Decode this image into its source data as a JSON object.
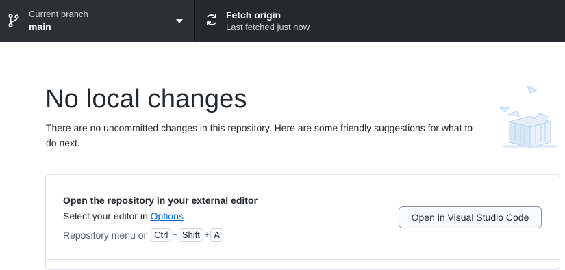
{
  "toolbar": {
    "branch": {
      "label": "Current branch",
      "value": "main",
      "icon": "git-branch-icon"
    },
    "fetch": {
      "title": "Fetch origin",
      "subtitle": "Last fetched just now",
      "icon": "sync-icon"
    }
  },
  "main": {
    "heading": "No local changes",
    "description": "There are no uncommitted changes in this repository. Here are some friendly suggestions for what to do next."
  },
  "suggestion": {
    "title": "Open the repository in your external editor",
    "line_prefix": "Select your editor in ",
    "line_link": "Options",
    "shortcut_prefix": "Repository menu or",
    "keys": [
      "Ctrl",
      "Shift",
      "A"
    ],
    "plus": "+",
    "button_label": "Open in Visual Studio Code"
  },
  "colors": {
    "toolbar_bg": "#24292e",
    "link": "#0366d6",
    "illustration": "#c8dff5"
  }
}
